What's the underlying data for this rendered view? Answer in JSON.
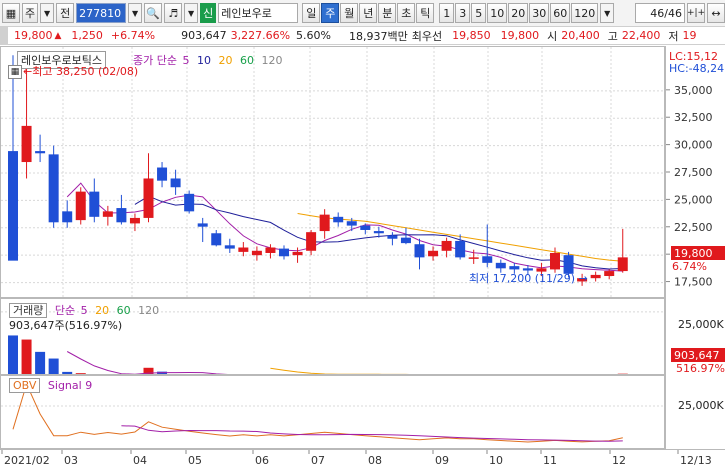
{
  "toolbar": {
    "btn_main": "주",
    "btn_jeon": "전",
    "code": "277810",
    "shin": "신",
    "stock_name": "레인보우로",
    "periods": [
      "일",
      "주",
      "월",
      "년",
      "분",
      "초",
      "틱"
    ],
    "selected_period": "주",
    "intervals": [
      "1",
      "3",
      "5",
      "10",
      "20",
      "30",
      "60",
      "120"
    ],
    "count": "46/46",
    "right_icons": [
      "+|+",
      "↔"
    ]
  },
  "quote": {
    "price": "19,800",
    "arrow": "▲",
    "change": "1,250",
    "change_pct": "+6.74%",
    "volume": "903,647",
    "volume_pct": "3,227.66%",
    "turnover": "5.60%",
    "amount": "18,937백만",
    "label_best": "최우선",
    "best_ask": "19,850",
    "best_bid": "19,800",
    "label_open": "시",
    "open": "20,400",
    "label_high": "고",
    "high": "22,400",
    "label_low": "저",
    "low": "19"
  },
  "price_pane": {
    "stock_label": "레인보우로보틱스",
    "ma_label": "종가 단순",
    "ma_periods": [
      "5",
      "10",
      "20",
      "60",
      "120"
    ],
    "max_note": "최고 38,250 (02/08)",
    "min_note": "최저 17,200 (11/29)",
    "lc": "LC:15,12",
    "hc": "HC:-48,24",
    "last_price": "19,800",
    "last_pct": "6.74%"
  },
  "volume_pane": {
    "label": "거래량",
    "ma_label": "단순",
    "ma_periods": [
      "5",
      "20",
      "60",
      "120"
    ],
    "info": "903,647주(516.97%)",
    "last_volume": "903,647",
    "last_pct": "516.97%"
  },
  "obv_pane": {
    "label": "OBV",
    "signal": "Signal 9"
  },
  "colors": {
    "up": "#e0191d",
    "down": "#1f4fd6",
    "ma5": "#a21fa8",
    "ma10": "#1f1f9a",
    "ma20": "#f0a000",
    "obv": "#e07020"
  },
  "chart_data": [
    {
      "type": "candlestick",
      "title": "레인보우로보틱스",
      "ylim": [
        16000,
        39000
      ],
      "y_ticks": [
        17500,
        20000,
        22500,
        25000,
        27500,
        30000,
        32500,
        35000
      ],
      "y_tick_labels": [
        "17,500",
        "20,000",
        "22,500",
        "25,000",
        "27,500",
        "30,000",
        "32,500",
        "35,000"
      ],
      "x_ticks": [
        "2021/02",
        "03",
        "04",
        "05",
        "06",
        "07",
        "08",
        "09",
        "10",
        "11",
        "12",
        "12/13"
      ],
      "candles": [
        {
          "o": 29500,
          "h": 38250,
          "l": 20500,
          "c": 19500
        },
        {
          "o": 28500,
          "h": 37500,
          "l": 27000,
          "c": 31800
        },
        {
          "o": 29500,
          "h": 31000,
          "l": 28500,
          "c": 29300
        },
        {
          "o": 29200,
          "h": 30000,
          "l": 22500,
          "c": 23000
        },
        {
          "o": 24000,
          "h": 25000,
          "l": 22500,
          "c": 23000
        },
        {
          "o": 23200,
          "h": 26200,
          "l": 22800,
          "c": 25800
        },
        {
          "o": 25800,
          "h": 27000,
          "l": 23000,
          "c": 23500
        },
        {
          "o": 23500,
          "h": 24500,
          "l": 22700,
          "c": 24000
        },
        {
          "o": 24300,
          "h": 25500,
          "l": 22800,
          "c": 23000
        },
        {
          "o": 22900,
          "h": 23800,
          "l": 22200,
          "c": 23400
        },
        {
          "o": 23400,
          "h": 29300,
          "l": 23000,
          "c": 27000
        },
        {
          "o": 28000,
          "h": 28500,
          "l": 26200,
          "c": 26800
        },
        {
          "o": 27000,
          "h": 27800,
          "l": 25500,
          "c": 26200
        },
        {
          "o": 25600,
          "h": 25900,
          "l": 23800,
          "c": 24000
        },
        {
          "o": 22900,
          "h": 23400,
          "l": 21200,
          "c": 22600
        },
        {
          "o": 22000,
          "h": 22300,
          "l": 20800,
          "c": 20900
        },
        {
          "o": 20900,
          "h": 21500,
          "l": 20200,
          "c": 20600
        },
        {
          "o": 20300,
          "h": 21200,
          "l": 19900,
          "c": 20700
        },
        {
          "o": 20000,
          "h": 20800,
          "l": 19500,
          "c": 20400
        },
        {
          "o": 20200,
          "h": 21000,
          "l": 19700,
          "c": 20700
        },
        {
          "o": 20600,
          "h": 20900,
          "l": 19600,
          "c": 19900
        },
        {
          "o": 20000,
          "h": 20700,
          "l": 19300,
          "c": 20300
        },
        {
          "o": 20400,
          "h": 22300,
          "l": 20000,
          "c": 22100
        },
        {
          "o": 22200,
          "h": 24200,
          "l": 21500,
          "c": 23700
        },
        {
          "o": 23500,
          "h": 23900,
          "l": 22600,
          "c": 23000
        },
        {
          "o": 23100,
          "h": 23400,
          "l": 22200,
          "c": 22700
        },
        {
          "o": 22700,
          "h": 22900,
          "l": 21900,
          "c": 22300
        },
        {
          "o": 22200,
          "h": 22600,
          "l": 21600,
          "c": 22000
        },
        {
          "o": 21800,
          "h": 22100,
          "l": 20900,
          "c": 21500
        },
        {
          "o": 21600,
          "h": 22500,
          "l": 21000,
          "c": 21100
        },
        {
          "o": 21000,
          "h": 21500,
          "l": 18700,
          "c": 19800
        },
        {
          "o": 19900,
          "h": 20800,
          "l": 19500,
          "c": 20400
        },
        {
          "o": 20400,
          "h": 21600,
          "l": 19800,
          "c": 21300
        },
        {
          "o": 21300,
          "h": 21900,
          "l": 19600,
          "c": 19800
        },
        {
          "o": 19800,
          "h": 20500,
          "l": 19200,
          "c": 19800
        },
        {
          "o": 19900,
          "h": 22800,
          "l": 18900,
          "c": 19300
        },
        {
          "o": 19300,
          "h": 19600,
          "l": 18400,
          "c": 18800
        },
        {
          "o": 19000,
          "h": 19300,
          "l": 18300,
          "c": 18700
        },
        {
          "o": 18800,
          "h": 19100,
          "l": 18200,
          "c": 18600
        },
        {
          "o": 18500,
          "h": 19300,
          "l": 18100,
          "c": 18800
        },
        {
          "o": 18700,
          "h": 20700,
          "l": 18400,
          "c": 20200
        },
        {
          "o": 20000,
          "h": 20300,
          "l": 18000,
          "c": 18300
        },
        {
          "o": 17600,
          "h": 18300,
          "l": 17200,
          "c": 17900
        },
        {
          "o": 17900,
          "h": 18500,
          "l": 17600,
          "c": 18200
        },
        {
          "o": 18100,
          "h": 18700,
          "l": 17800,
          "c": 18550
        },
        {
          "o": 18550,
          "h": 22400,
          "l": 18400,
          "c": 19800
        }
      ],
      "ma20_start": 21,
      "ma20": [
        23800,
        23600,
        23400,
        23300,
        23200,
        23100,
        22900,
        22700,
        22500,
        22300,
        22100,
        21900,
        21700,
        21500,
        21300,
        21100,
        20900,
        20700,
        20500,
        20300,
        20100,
        19900,
        19700,
        19550,
        19450
      ]
    },
    {
      "type": "bar",
      "title": "거래량",
      "ylabel_ticks": [
        "25,000K"
      ],
      "values": [
        15800,
        14200,
        9400,
        6800,
        1600,
        1100,
        700,
        600,
        500,
        650,
        3200,
        1700,
        650,
        600,
        550,
        500,
        450,
        420,
        400,
        380,
        370,
        360,
        380,
        420,
        380,
        360,
        340,
        330,
        320,
        310,
        300,
        290,
        280,
        300,
        260,
        280,
        250,
        240,
        230,
        240,
        260,
        250,
        230,
        220,
        175,
        903
      ],
      "ylim": [
        0,
        30000
      ]
    },
    {
      "type": "line",
      "title": "OBV",
      "ylabel_ticks": [
        "25,000K"
      ]
    }
  ]
}
